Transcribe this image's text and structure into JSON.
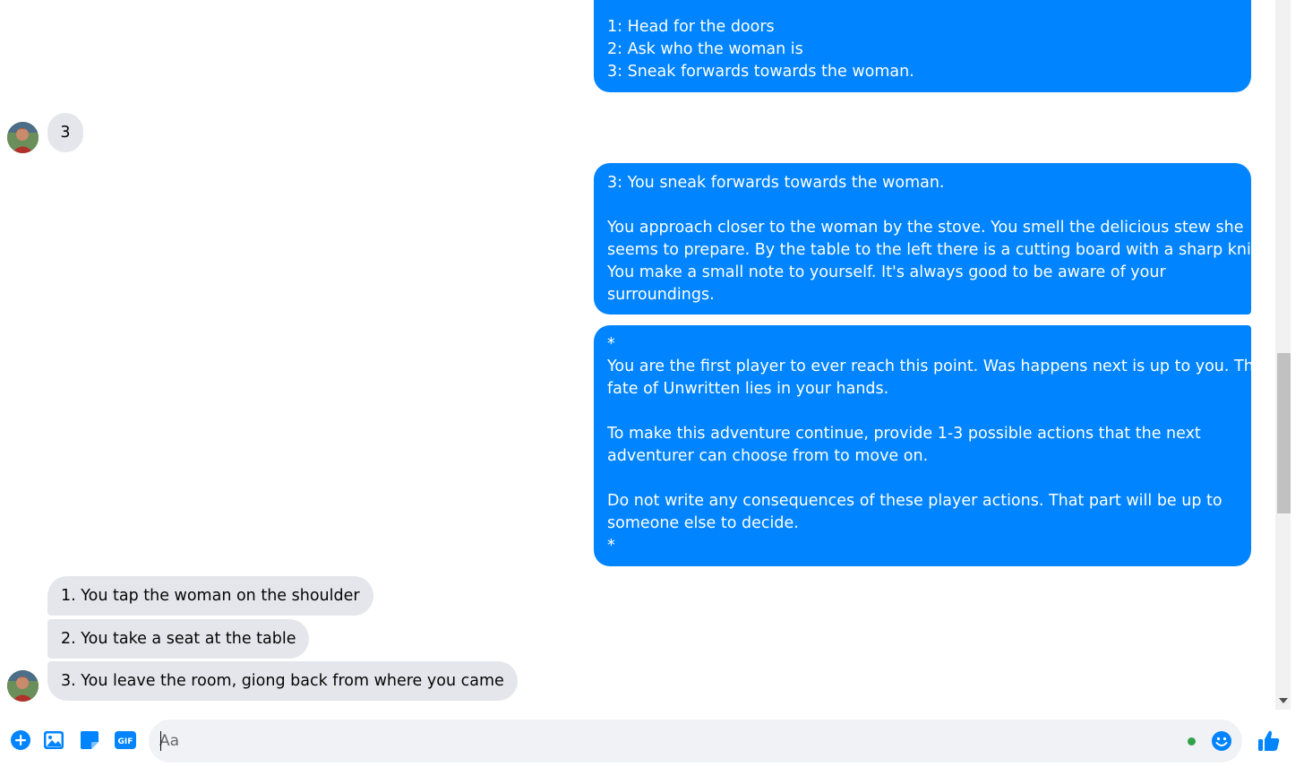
{
  "colors": {
    "accent": "#0084ff",
    "incoming_bubble": "#e4e6eb",
    "online_dot": "#31a24c"
  },
  "messages": {
    "out1": {
      "lines": [
        "",
        "1: Head for the doors",
        "2: Ask who the woman is",
        "3: Sneak forwards towards the woman."
      ]
    },
    "in1": {
      "text": "3"
    },
    "out2": {
      "lines": [
        "3: You sneak forwards towards the woman.",
        "",
        "You approach closer to the woman by the stove. You smell the delicious stew she",
        "seems to prepare. By the table to the left there is a cutting board with a sharp knife.",
        "You make a small note to yourself. It's always good to be aware of your",
        "surroundings."
      ]
    },
    "out3": {
      "lines": [
        "*",
        "You are the first player to ever reach this point. Was happens next is up to you. The",
        "fate of Unwritten lies in your hands.",
        "",
        "To make this adventure continue, provide 1-3 possible actions that the next",
        "adventurer can choose from to move on.",
        "",
        "Do not write any consequences of these player actions. That part will be up to",
        "someone else to decide.",
        "*"
      ]
    },
    "in2": {
      "text": "1. You tap the woman on the shoulder"
    },
    "in3": {
      "text": "2. You take a seat at the table"
    },
    "in4": {
      "text": "3. You leave the room, giong back from where you came"
    }
  },
  "composer": {
    "placeholder": "Aa",
    "icons": [
      "plus-circle-icon",
      "image-icon",
      "sticker-icon",
      "gif-icon",
      "emoji-icon",
      "thumbs-up-icon"
    ],
    "gif_label": "GIF"
  },
  "avatar": {
    "icon": "user-avatar"
  }
}
